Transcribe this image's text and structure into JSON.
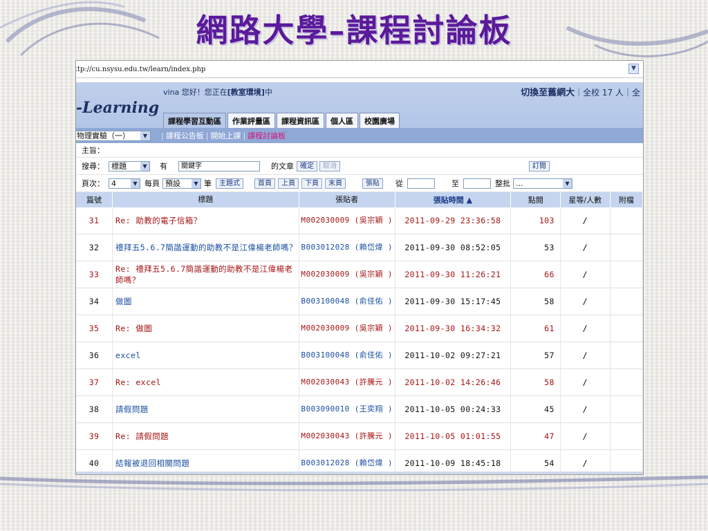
{
  "slide": {
    "title": "網路大學–課程討論板"
  },
  "browser": {
    "url": "ttp://cu.nsysu.edu.tw/learn/index.php"
  },
  "header": {
    "logo": "-Learning",
    "greeting": {
      "user": "vina",
      "text_before": " 您好！您正在",
      "location": "[教室環境]",
      "text_after": "中"
    },
    "switch_label": "切換至舊網大",
    "online": "｜全校 17 人｜全",
    "tabs": [
      "課程學習互動區",
      "作業評量區",
      "課程資訊區",
      "個人區",
      "校園廣場"
    ]
  },
  "subnav": {
    "course": "物理實驗（一）",
    "links": [
      "課程公告板",
      "開始上課",
      "課程討論板"
    ]
  },
  "board": {
    "subject_label": "主旨：",
    "search_label": "搜尋：",
    "search_field": "標題",
    "has_label": "有",
    "keyword_value": "關鍵字",
    "of_articles": "的文章",
    "confirm": "確定",
    "cancel": "取消",
    "subscribe": "訂閱",
    "page_label": "頁次：",
    "page_value": "4",
    "per_page": "每頁",
    "per_page_value": "預設",
    "unit": "筆",
    "threaded": "主題式",
    "first": "首頁",
    "prev": "上頁",
    "next": "下頁",
    "last": "末頁",
    "post": "張貼",
    "from": "從",
    "to": "至",
    "batch": "整批",
    "batch_value": "..."
  },
  "table": {
    "headers": [
      "篇號",
      "標題",
      "張貼者",
      "張貼時間 ▲",
      "點閱",
      "星等/人數",
      "附檔"
    ],
    "rows": [
      {
        "no": "31",
        "title": "Re: 助教的電子信箱？",
        "poster": "M002030009 (吳宗穎 )",
        "time": "2011-09-29 23:36:58",
        "views": "103",
        "star": "/",
        "type": "reply"
      },
      {
        "no": "32",
        "title": "禮拜五5.6.7簡諧運動的助教不是江偉楊老師嗎？",
        "poster": "B003012028 (賴岱煒 )",
        "time": "2011-09-30 08:52:05",
        "views": "53",
        "star": "/",
        "type": "post"
      },
      {
        "no": "33",
        "title": "Re: 禮拜五5.6.7簡諧運動的助教不是江偉楊老師嗎？",
        "poster": "M002030009 (吳宗穎 )",
        "time": "2011-09-30 11:26:21",
        "views": "66",
        "star": "/",
        "type": "reply"
      },
      {
        "no": "34",
        "title": "做圖",
        "poster": "B003100048 (俞佳佑 )",
        "time": "2011-09-30 15:17:45",
        "views": "58",
        "star": "/",
        "type": "post"
      },
      {
        "no": "35",
        "title": "Re: 做圖",
        "poster": "M002030009 (吳宗穎 )",
        "time": "2011-09-30 16:34:32",
        "views": "61",
        "star": "/",
        "type": "reply"
      },
      {
        "no": "36",
        "title": "excel",
        "poster": "B003100048 (俞佳佑 )",
        "time": "2011-10-02 09:27:21",
        "views": "57",
        "star": "/",
        "type": "post"
      },
      {
        "no": "37",
        "title": "Re: excel",
        "poster": "M002030043 (許騰元 )",
        "time": "2011-10-02 14:26:46",
        "views": "58",
        "star": "/",
        "type": "reply"
      },
      {
        "no": "38",
        "title": "請假問題",
        "poster": "B003090010 (王奕翔 )",
        "time": "2011-10-05 00:24:33",
        "views": "45",
        "star": "/",
        "type": "post"
      },
      {
        "no": "39",
        "title": "Re: 請假問題",
        "poster": "M002030043 (許騰元 )",
        "time": "2011-10-05 01:01:55",
        "views": "47",
        "star": "/",
        "type": "reply"
      },
      {
        "no": "40",
        "title": "結報被退回相關問題",
        "poster": "B003012028 (賴岱煒 )",
        "time": "2011-10-09 18:45:18",
        "views": "54",
        "star": "/",
        "type": "post"
      }
    ]
  },
  "colors": {
    "title": "#5a1a9a",
    "header_bg": "#b9cbe9",
    "subnav_bg": "#8fa8d6",
    "reply": "#a51414",
    "post": "#1b4fa0"
  }
}
